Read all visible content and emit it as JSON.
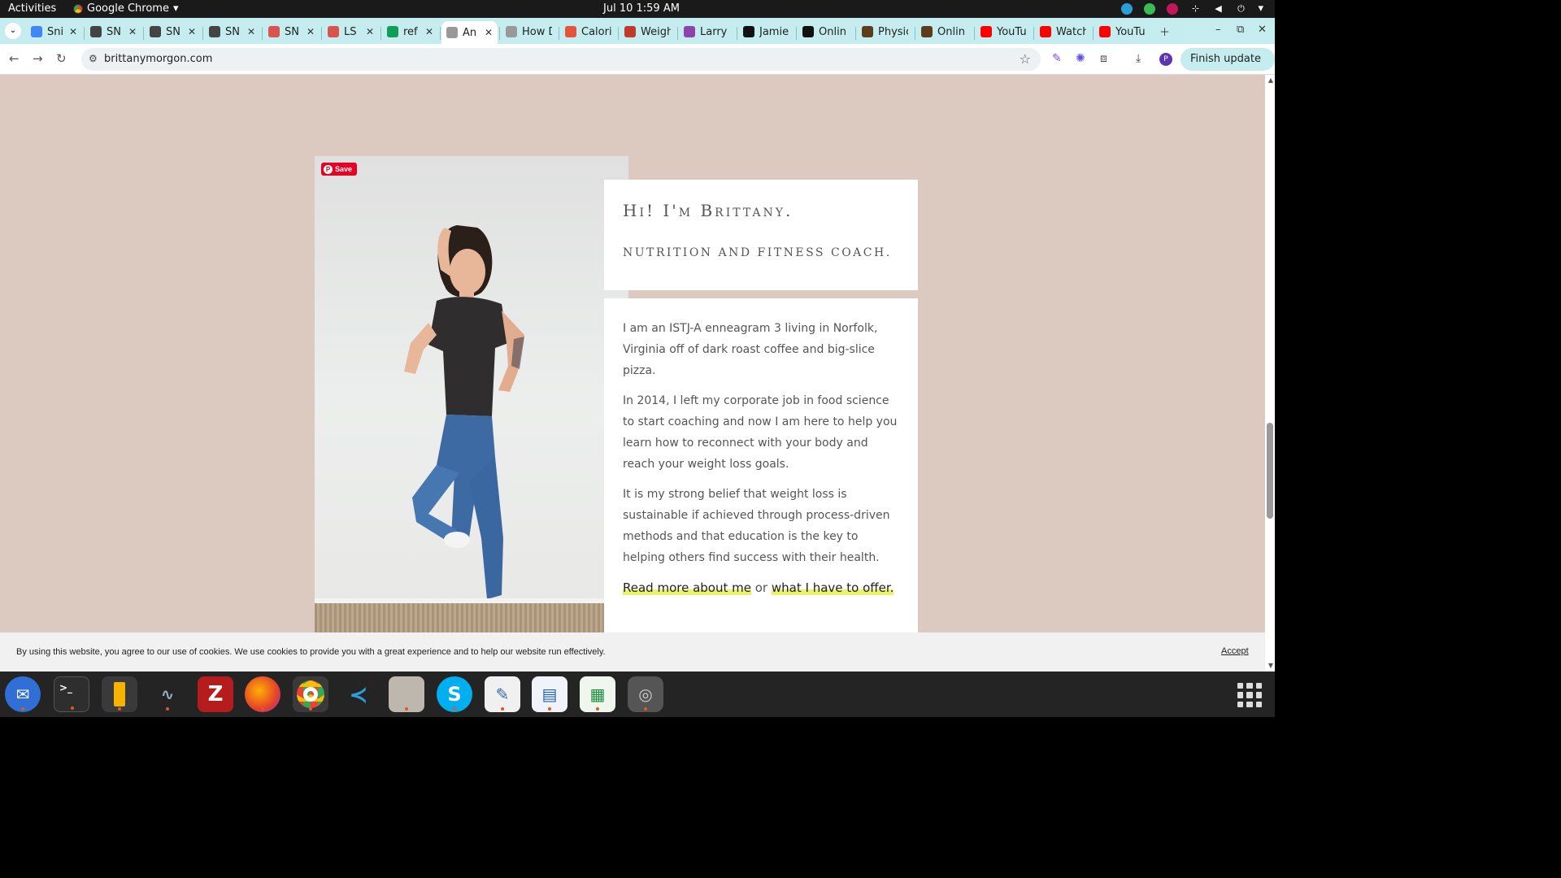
{
  "topbar": {
    "activities": "Activities",
    "app_name": "Google Chrome",
    "clock": "Jul 10  1:59 AM"
  },
  "tabs": [
    {
      "title": "Sni",
      "icon": "google-docs-icon",
      "color": "#4285f4"
    },
    {
      "title": "SN",
      "icon": "snp-icon",
      "color": "#444444"
    },
    {
      "title": "SN",
      "icon": "snp-icon",
      "color": "#444444"
    },
    {
      "title": "SN",
      "icon": "snp-icon",
      "color": "#444444"
    },
    {
      "title": "SN",
      "icon": "food-icon",
      "color": "#d9534f"
    },
    {
      "title": "LS",
      "icon": "food-icon",
      "color": "#d9534f"
    },
    {
      "title": "ref",
      "icon": "google-sheets-plus-icon",
      "color": "#0f9d58"
    },
    {
      "title": "An",
      "icon": "site-icon",
      "color": "#999999",
      "active": true
    },
    {
      "title": "How D",
      "icon": "site-icon",
      "color": "#999999"
    },
    {
      "title": "Calori",
      "icon": "calorie-icon",
      "color": "#e5533d"
    },
    {
      "title": "Weigh",
      "icon": "weight-icon",
      "color": "#c0392b"
    },
    {
      "title": "Larry",
      "icon": "larry-icon",
      "color": "#8e44ad"
    },
    {
      "title": "Jamie",
      "icon": "black-square-icon",
      "color": "#111111"
    },
    {
      "title": "Onlin",
      "icon": "black-square-icon",
      "color": "#111111"
    },
    {
      "title": "Physic",
      "icon": "physique-icon",
      "color": "#5a3d1a"
    },
    {
      "title": "Onlin",
      "icon": "physique-icon",
      "color": "#5a3d1a"
    },
    {
      "title": "YouTu",
      "icon": "youtube-icon",
      "color": "#ff0000"
    },
    {
      "title": "Watch",
      "icon": "youtube-icon",
      "color": "#ff0000"
    },
    {
      "title": "YouTu",
      "icon": "youtube-icon",
      "color": "#ff0000"
    }
  ],
  "toolbar": {
    "url": "brittanymorgon.com",
    "profile_initial": "P",
    "finish_update": "Finish update"
  },
  "page": {
    "save_button": "Save",
    "heading": "Hi! I'm Brittany.",
    "subheading": "Nutrition and Fitness Coach.",
    "paragraphs": [
      "I am an ISTJ-A enneagram 3 living in Norfolk, Virginia off of dark roast coffee and big-slice pizza.",
      "In 2014, I left my corporate job in food science to start coaching and now I am here to help you learn how to reconnect with your body and reach your weight loss goals.",
      "It is my strong belief that weight loss is sustainable if achieved through process-driven methods and that education is the key to helping others find success with their health."
    ],
    "link_about": "Read more about me",
    "link_or": "or",
    "link_offer": "what I have to offer.",
    "background_color": "#dccac0",
    "highlight_color": "#e8f26a"
  },
  "cookie": {
    "message": "By using this website, you agree to our use of cookies. We use cookies to provide you with a great experience and to help our website run effectively.",
    "accept": "Accept"
  },
  "dock": {
    "items": [
      "thunderbird-icon",
      "terminal-icon",
      "calculator-icon",
      "system-monitor-icon",
      "filezilla-icon",
      "firefox-icon",
      "chrome-icon",
      "vscode-icon",
      "files-icon",
      "skype-icon",
      "text-editor-icon",
      "libreoffice-writer-icon",
      "libreoffice-calc-icon",
      "disk-icon"
    ]
  }
}
